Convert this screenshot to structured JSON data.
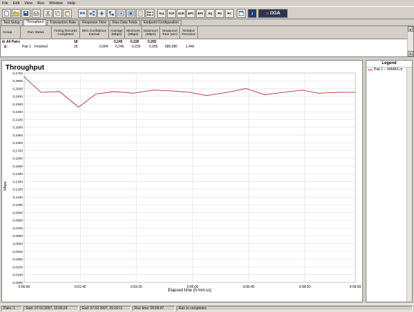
{
  "menu": [
    "File",
    "Edit",
    "View",
    "Run",
    "Window",
    "Help"
  ],
  "toolbar": {
    "pair_label_1": "Pair 1",
    "pair_label_2": "Pair 2",
    "buttons": [
      "ALL",
      "TCP",
      "SCR",
      "EP1",
      "EP2",
      "SQ",
      "PG",
      "PC"
    ],
    "brand": "IXIA"
  },
  "tabs": [
    "Test Setup",
    "Throughput",
    "Transaction Rate",
    "Response Time",
    "Raw Data Totals",
    "Endpoint Configuration"
  ],
  "active_tab": "Throughput",
  "grid": {
    "headers": [
      "Group",
      "Run Status",
      "Timing Records Completed",
      "95% Confidence Interval",
      "Average (Mbps)",
      "Minimum (Mbps)",
      "Maximum (Mbps)",
      "Measured Time (sec)",
      "Relative Precision"
    ],
    "all_pairs": {
      "group": "All Pairs",
      "records": "18",
      "average": "0,245",
      "minimum": "0,226",
      "maximum": "0,265"
    },
    "pair1": {
      "group": "Pair 1",
      "status": "Finished",
      "records": "18",
      "confidence": "0,004",
      "average": "0,245",
      "minimum": "0,226",
      "maximum": "0,265",
      "measured": "586,580",
      "precision": "1,446"
    }
  },
  "chart_data": {
    "type": "line",
    "title": "Throughput",
    "ylabel": "Mbps",
    "xlabel": "Elapsed time (h:mm:ss)",
    "ylim": [
      0,
      0.27
    ],
    "xlim": [
      0,
      590
    ],
    "yticks": [
      "0,0000",
      "0,0100",
      "0,0200",
      "0,0300",
      "0,0400",
      "0,0500",
      "0,0600",
      "0,0700",
      "0,0800",
      "0,0900",
      "0,1000",
      "0,1100",
      "0,1200",
      "0,1300",
      "0,1400",
      "0,1500",
      "0,1600",
      "0,1700",
      "0,1800",
      "0,1900",
      "0,2000",
      "0,2100",
      "0,2200",
      "0,2300",
      "0,2400",
      "0,2500",
      "0,2600",
      "0,2700"
    ],
    "xticks": [
      "0:00:00",
      "0:01:40",
      "0:03:20",
      "0:05:00",
      "0:06:40",
      "0:08:20",
      "0:09:50"
    ],
    "xtick_values": [
      0,
      100,
      200,
      300,
      400,
      500,
      590
    ],
    "grid": true,
    "color": "#b03030",
    "series": [
      {
        "name": "Pair 1 -- WiMAX.m",
        "x": [
          0,
          30,
          63,
          97,
          128,
          160,
          195,
          230,
          262,
          295,
          325,
          362,
          395,
          428,
          462,
          495,
          525,
          560,
          590
        ],
        "y": [
          0.265,
          0.245,
          0.246,
          0.226,
          0.243,
          0.246,
          0.244,
          0.248,
          0.247,
          0.245,
          0.241,
          0.245,
          0.25,
          0.242,
          0.245,
          0.248,
          0.244,
          0.245,
          0.245
        ]
      }
    ]
  },
  "legend": {
    "title": "Legend",
    "item": "Pair 1 -- WiMAX.m"
  },
  "status": {
    "pairs": "Pairs: 1",
    "start": "Start: 07.02.2007, 15:06:24",
    "end": "End: 07.02.2007, 15:16:11",
    "runtime": "Run time: 00:09:47",
    "result": "Ran to completion"
  }
}
